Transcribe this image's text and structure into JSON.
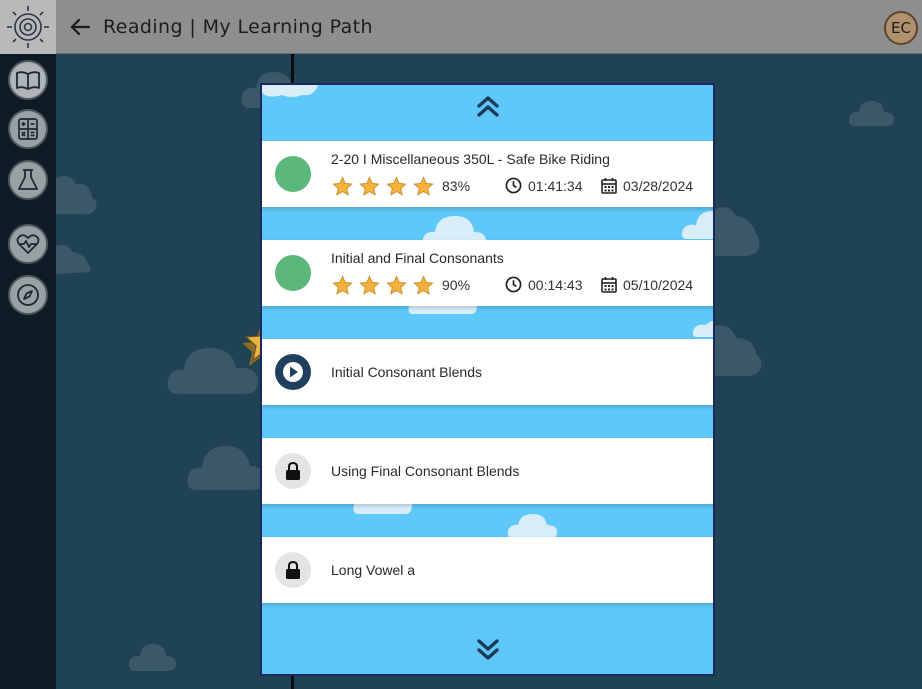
{
  "header": {
    "title": "Reading | My Learning Path",
    "avatar_initials": "EC"
  },
  "sidebar": {
    "items": [
      {
        "name": "reading",
        "icon": "open-book-icon",
        "active": true
      },
      {
        "name": "math",
        "icon": "calculator-icon",
        "active": false
      },
      {
        "name": "science",
        "icon": "flask-icon",
        "active": false
      },
      {
        "name": "health",
        "icon": "heart-pulse-icon",
        "active": false
      },
      {
        "name": "explore",
        "icon": "compass-icon",
        "active": false
      }
    ]
  },
  "lessons": [
    {
      "name": "2-20 I Miscellaneous 350L - Safe Bike Riding",
      "status": "completed",
      "stars": 4,
      "score": "83%",
      "time": "01:41:34",
      "date": "03/28/2024"
    },
    {
      "name": "Initial and Final Consonants",
      "status": "completed",
      "stars": 4,
      "score": "90%",
      "time": "00:14:43",
      "date": "05/10/2024"
    },
    {
      "name": "Initial Consonant Blends",
      "status": "current"
    },
    {
      "name": "Using Final Consonant Blends",
      "status": "locked"
    },
    {
      "name": "Long Vowel a",
      "status": "locked"
    }
  ],
  "colors": {
    "completed": "#5cb77a",
    "current": "#1e3f5d",
    "star": "#f5b13d",
    "panel": "#5ec8f8"
  }
}
